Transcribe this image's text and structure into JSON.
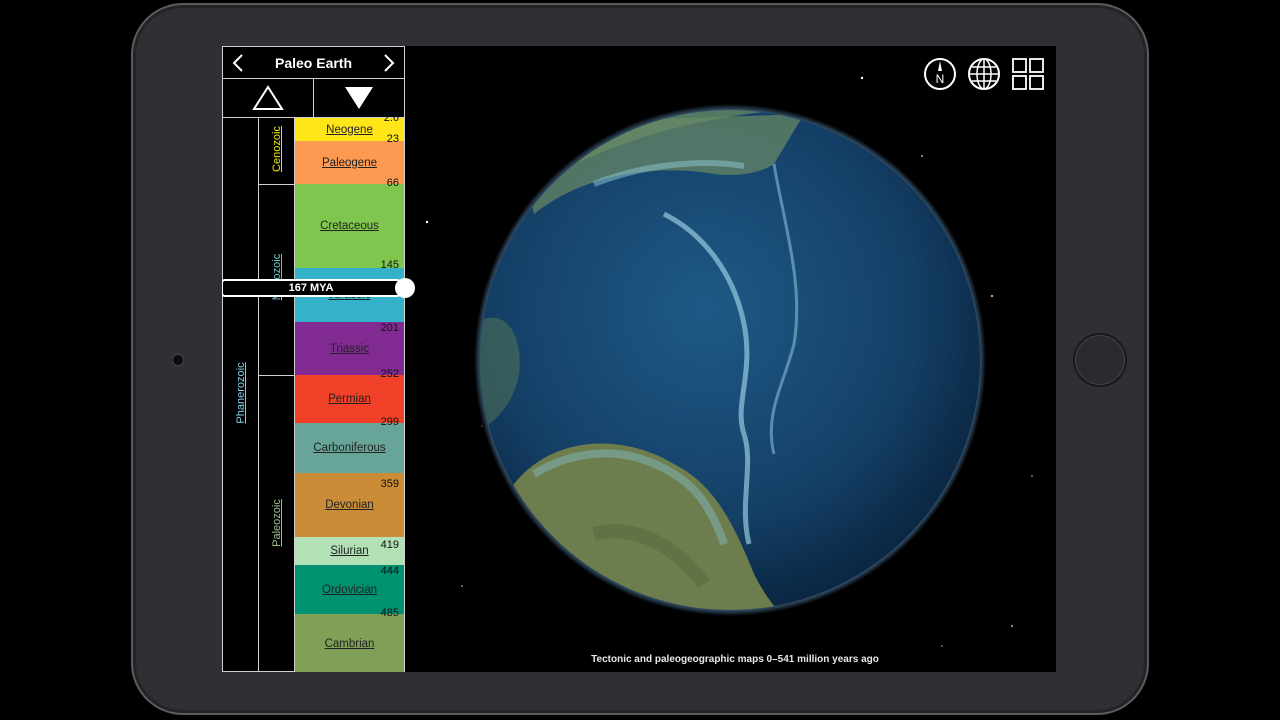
{
  "app": {
    "title": "Paleo Earth",
    "prev_icon": "chevron-left-icon",
    "next_icon": "chevron-right-icon",
    "up_icon": "triangle-up-outline-icon",
    "down_icon": "triangle-down-filled-icon"
  },
  "timescale": {
    "eon": "Phanerozoic",
    "eras": [
      {
        "name": "Cenozoic",
        "color": "#f2e200"
      },
      {
        "name": "Mesozoic",
        "color": "#67c5ca"
      },
      {
        "name": "Paleozoic",
        "color": "#99c08d"
      }
    ],
    "periods": [
      {
        "name": "Neogene",
        "color": "#ffe619"
      },
      {
        "name": "Paleogene",
        "color": "#fd9a52"
      },
      {
        "name": "Cretaceous",
        "color": "#7fc64e"
      },
      {
        "name": "Jurassic",
        "color": "#34b2c9"
      },
      {
        "name": "Triassic",
        "color": "#812b92"
      },
      {
        "name": "Permian",
        "color": "#f04028"
      },
      {
        "name": "Carboniferous",
        "color": "#67a599"
      },
      {
        "name": "Devonian",
        "color": "#cb8c37"
      },
      {
        "name": "Silurian",
        "color": "#b3e1b6"
      },
      {
        "name": "Ordovician",
        "color": "#009270"
      },
      {
        "name": "Cambrian",
        "color": "#7fa056"
      }
    ],
    "boundaries": [
      "2.6",
      "23",
      "66",
      "145",
      "201",
      "252",
      "299",
      "359",
      "419",
      "444",
      "485"
    ]
  },
  "slider": {
    "label": "167 MYA"
  },
  "toolbar": {
    "icons": [
      "compass-north-icon",
      "globe-icon",
      "grid-icon"
    ]
  },
  "caption": "Tectonic and paleogeographic maps 0–541 million years ago"
}
